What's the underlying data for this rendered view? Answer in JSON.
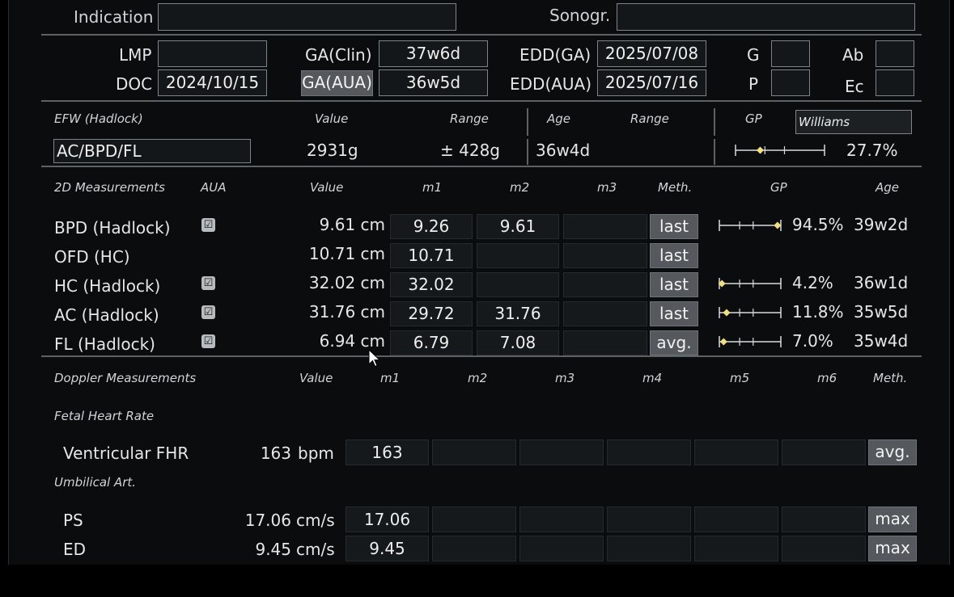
{
  "header": {
    "indication_label": "Indication",
    "indication_value": "",
    "sonogr_label": "Sonogr.",
    "sonogr_value": "",
    "lmp_label": "LMP",
    "lmp_value": "",
    "doc_label": "DOC",
    "doc_value": "2024/10/15",
    "ga_clin_label": "GA(Clin)",
    "ga_clin_value": "37w6d",
    "ga_aua_label": "GA(AUA)",
    "ga_aua_value": "36w5d",
    "edd_ga_label": "EDD(GA)",
    "edd_ga_value": "2025/07/08",
    "edd_aua_label": "EDD(AUA)",
    "edd_aua_value": "2025/07/16",
    "g_label": "G",
    "g_value": "",
    "p_label": "P",
    "p_value": "",
    "ab_label": "Ab",
    "ab_value": "",
    "ec_label": "Ec",
    "ec_value": ""
  },
  "efw": {
    "title": "EFW (Hadlock)",
    "col_value": "Value",
    "col_range": "Range",
    "col_age": "Age",
    "col_age_range": "Range",
    "col_gp": "GP",
    "formula": "AC/BPD/FL",
    "value": "2931g",
    "range": "± 428g",
    "age": "36w4d",
    "gp_author": "Williams",
    "gp_percent": "27.7%",
    "gp_marker": 0.277
  },
  "measurements_2d": {
    "headers": {
      "name": "2D Measurements",
      "aua": "AUA",
      "value": "Value",
      "m1": "m1",
      "m2": "m2",
      "m3": "m3",
      "meth": "Meth.",
      "gp": "GP",
      "age": "Age"
    },
    "rows": [
      {
        "name": "BPD (Hadlock)",
        "aua": "☑",
        "value": "9.61 cm",
        "m1": "9.26",
        "m2": "9.61",
        "m3": "",
        "meth": "last",
        "gp": "94.5%",
        "gp_marker": 0.945,
        "age": "39w2d"
      },
      {
        "name": "OFD (HC)",
        "aua": "",
        "value": "10.71 cm",
        "m1": "10.71",
        "m2": "",
        "m3": "",
        "meth": "last",
        "gp": "",
        "gp_marker": null,
        "age": ""
      },
      {
        "name": "HC (Hadlock)",
        "aua": "☑",
        "value": "32.02 cm",
        "m1": "32.02",
        "m2": "",
        "m3": "",
        "meth": "last",
        "gp": "4.2%",
        "gp_marker": 0.042,
        "age": "36w1d"
      },
      {
        "name": "AC (Hadlock)",
        "aua": "☑",
        "value": "31.76 cm",
        "m1": "29.72",
        "m2": "31.76",
        "m3": "",
        "meth": "last",
        "gp": "11.8%",
        "gp_marker": 0.118,
        "age": "35w5d"
      },
      {
        "name": "FL (Hadlock)",
        "aua": "☑",
        "value": "6.94 cm",
        "m1": "6.79",
        "m2": "7.08",
        "m3": "",
        "meth": "avg.",
        "gp": "7.0%",
        "gp_marker": 0.07,
        "age": "35w4d"
      }
    ]
  },
  "doppler": {
    "headers": {
      "name": "Doppler Measurements",
      "value": "Value",
      "m1": "m1",
      "m2": "m2",
      "m3": "m3",
      "m4": "m4",
      "m5": "m5",
      "m6": "m6",
      "meth": "Meth."
    },
    "fhr_section": "Fetal Heart Rate",
    "fhr": {
      "name": "Ventricular FHR",
      "value": "163",
      "unit": "bpm",
      "m1": "163",
      "meth": "avg."
    },
    "umb_section": "Umbilical Art.",
    "ps": {
      "name": "PS",
      "value": "17.06",
      "unit": "cm/s",
      "m1": "17.06",
      "meth": "max"
    },
    "ed": {
      "name": "ED",
      "value": "9.45",
      "unit": "cm/s",
      "m1": "9.45",
      "meth": "max"
    }
  },
  "colors": {
    "marker": "#f0e080",
    "background": "#0a0c0e",
    "button": "#55595d"
  }
}
